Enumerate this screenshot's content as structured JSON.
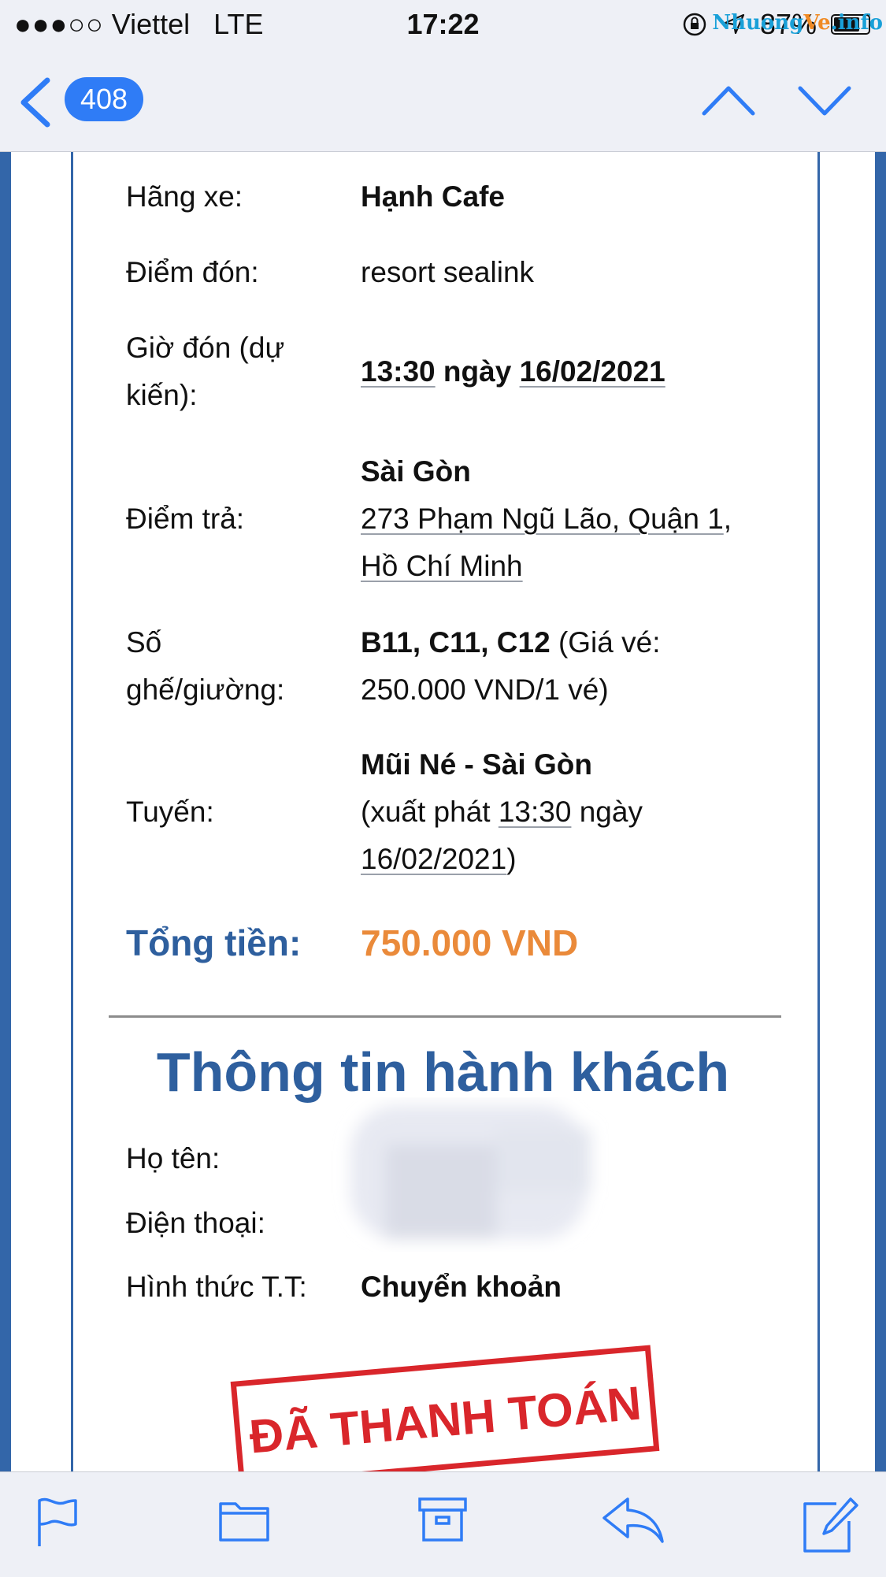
{
  "status_bar": {
    "signal": "●●●○○",
    "carrier": "Viettel",
    "network": "LTE",
    "time": "17:22",
    "battery": "87%",
    "watermark_a": "Nhuong",
    "watermark_b": "Ve",
    "watermark_c": ".info"
  },
  "nav": {
    "unread_count": "408",
    "accent": "#2f7cf6"
  },
  "booking": {
    "carrier_label": "Hãng xe:",
    "carrier_value": "Hạnh Cafe",
    "pickup_label": "Điểm đón:",
    "pickup_value": "resort sealink",
    "pickup_time_label_1": "Giờ đón (dự",
    "pickup_time_label_2": "kiến):",
    "pickup_time": "13:30",
    "pickup_time_mid": "ngày",
    "pickup_date": "16/02/2021",
    "dropoff_label": "Điểm trả:",
    "dropoff_city": "Sài Gòn",
    "dropoff_address_1": "273 Phạm Ngũ Lão, Quận 1",
    "dropoff_address_sep": ",",
    "dropoff_address_2": "Hồ Chí Minh",
    "seats_label_1": "Số",
    "seats_label_2": "ghế/giường:",
    "seats_value": "B11, C11, C12",
    "seats_price_1": "(Giá vé:",
    "seats_price_2": "250.000 VND/1 vé)",
    "route_label": "Tuyến:",
    "route_value": "Mũi Né - Sài Gòn",
    "route_depart_prefix": "(xuất phát",
    "route_depart_time": "13:30",
    "route_depart_mid": "ngày",
    "route_depart_date": "16/02/2021",
    "route_depart_suffix": ")",
    "total_label": "Tổng tiền:",
    "total_value": "750.000 VND",
    "total_label_color": "#2e5f9e",
    "total_value_color": "#ea8a3a"
  },
  "passenger": {
    "section_title": "Thông tin hành khách",
    "name_label": "Họ tên:",
    "phone_label": "Điện thoại:",
    "payment_label": "Hình thức T.T:",
    "payment_value": "Chuyển khoản",
    "stamp_text": "ĐÃ THANH TOÁN",
    "stamp_color": "#d9262b"
  },
  "toolbar": {
    "icons": [
      "flag-icon",
      "folder-icon",
      "archive-icon",
      "reply-icon",
      "compose-icon"
    ]
  }
}
